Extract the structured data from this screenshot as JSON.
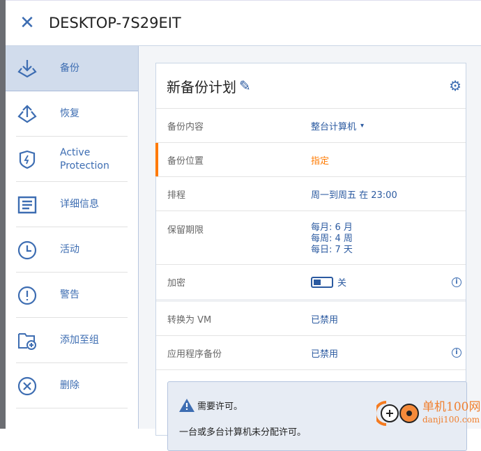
{
  "header": {
    "title": "DESKTOP-7S29EIT"
  },
  "sidebar": {
    "items": [
      {
        "label": "备份",
        "icon": "backup-icon"
      },
      {
        "label": "恢复",
        "icon": "recover-icon"
      },
      {
        "label": "Active Protection",
        "icon": "shield-icon"
      },
      {
        "label": "详细信息",
        "icon": "details-icon"
      },
      {
        "label": "活动",
        "icon": "clock-icon"
      },
      {
        "label": "警告",
        "icon": "alert-icon"
      },
      {
        "label": "添加至组",
        "icon": "add-folder-icon"
      },
      {
        "label": "删除",
        "icon": "delete-icon"
      }
    ]
  },
  "plan": {
    "title": "新备份计划",
    "rows": [
      {
        "key": "备份内容",
        "value": "整台计算机"
      },
      {
        "key": "备份位置",
        "value": "指定"
      },
      {
        "key": "排程",
        "value": "周一到周五 在 23:00"
      },
      {
        "key": "保留期限",
        "value1": "每月: 6 月",
        "value2": "每周: 4 周",
        "value3": "每日: 7 天"
      },
      {
        "key": "加密",
        "value": "关"
      },
      {
        "key": "转换为 VM",
        "value": "已禁用"
      },
      {
        "key": "应用程序备份",
        "value": "已禁用"
      }
    ],
    "notice": {
      "title": "需要许可。",
      "text": "一台或多台计算机未分配许可。"
    }
  },
  "watermark": {
    "text1": "单机100网",
    "text2": "danji100.com"
  },
  "colors": {
    "accent": "#3d6db2",
    "warning": "#ff7a00"
  }
}
